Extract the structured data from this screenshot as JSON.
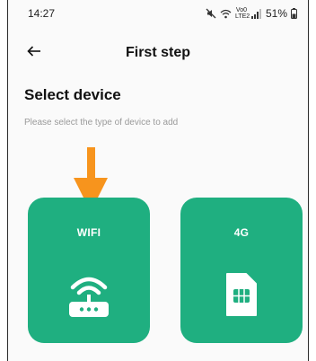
{
  "status_bar": {
    "time": "14:27",
    "net_label_top": "Vo0",
    "net_label_bottom": "LTE2",
    "battery": "51%"
  },
  "header": {
    "title": "First step",
    "back_icon": "arrow-left-icon"
  },
  "main": {
    "section_title": "Select device",
    "section_subtitle": "Please select the type of device to add",
    "pointer_icon": "down-arrow-icon",
    "accent_color": "#1faf80",
    "pointer_color": "#f7941d",
    "devices": [
      {
        "label": "WIFI",
        "icon": "wifi-router-icon"
      },
      {
        "label": "4G",
        "icon": "sim-card-icon"
      }
    ]
  }
}
